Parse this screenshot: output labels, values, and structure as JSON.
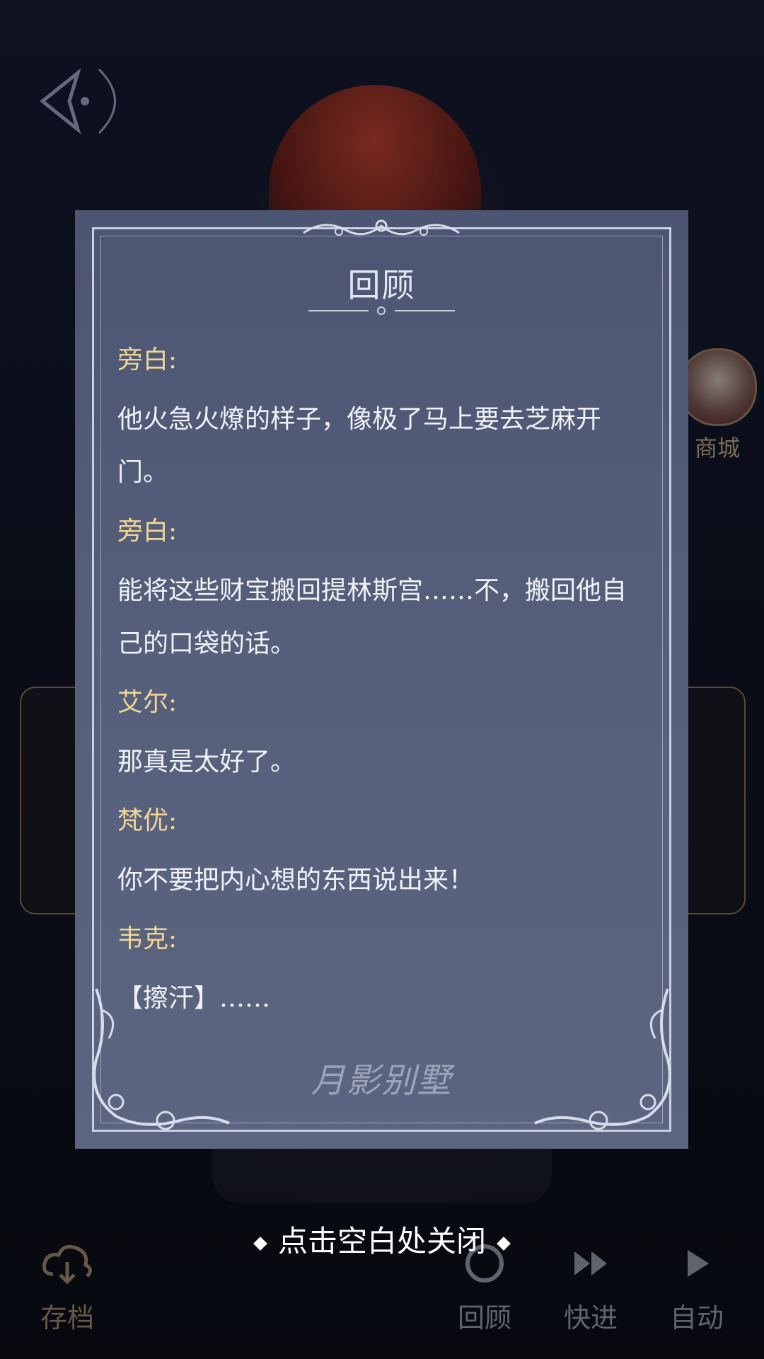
{
  "background": {
    "shop_label": "商城",
    "bottom_bar": {
      "save_label": "存档",
      "review_label": "回顾",
      "fast_forward_label": "快进",
      "auto_label": "自动"
    }
  },
  "review_panel": {
    "title": "回顾",
    "entries": [
      {
        "speaker": "旁白:",
        "text": "他火急火燎的样子，像极了马上要去芝麻开门。"
      },
      {
        "speaker": "旁白:",
        "text": "能将这些财宝搬回提林斯宫……不，搬回他自己的口袋的话。"
      },
      {
        "speaker": "艾尔:",
        "text": "那真是太好了。"
      },
      {
        "speaker": "梵优:",
        "text": "你不要把内心想的东西说出来！"
      },
      {
        "speaker": "韦克:",
        "text": "【擦汗】……"
      }
    ],
    "watermark": "月影别墅"
  },
  "close_hint": "点击空白处关闭",
  "colors": {
    "panel_bg": "#56607c",
    "speaker": "#f1d592",
    "text": "#f0f2f6",
    "frame": "#c8d0e2"
  }
}
